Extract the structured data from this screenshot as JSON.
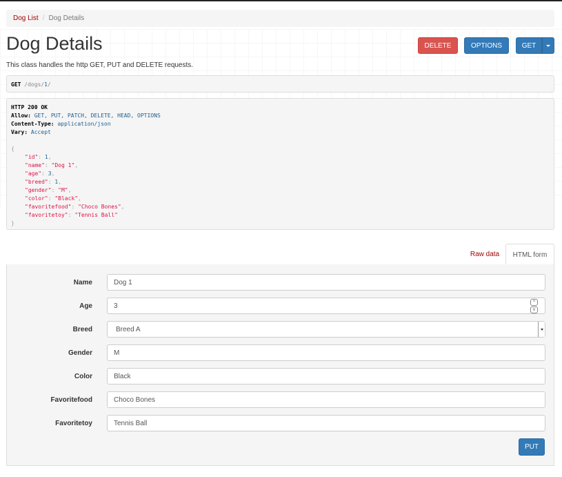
{
  "breadcrumb": {
    "home": "Dog List",
    "separator": "/",
    "current": "Dog Details"
  },
  "page": {
    "title": "Dog Details",
    "description": "This class handles the http GET, PUT and DELETE requests."
  },
  "buttons": {
    "delete": "DELETE",
    "options": "OPTIONS",
    "get": "GET"
  },
  "request": {
    "method": "GET",
    "path_prefix": " /dogs/",
    "path_id": "1",
    "path_suffix": "/"
  },
  "response": {
    "status": "HTTP 200 OK",
    "headers": [
      {
        "key": "Allow:",
        "value": "GET, PUT, PATCH, DELETE, HEAD, OPTIONS"
      },
      {
        "key": "Content-Type:",
        "value": "application/json"
      },
      {
        "key": "Vary:",
        "value": "Accept"
      }
    ],
    "open_brace": "{",
    "close_brace": "}",
    "body": [
      {
        "key": "\"id\"",
        "value": "1",
        "type": "lit",
        "comma": ","
      },
      {
        "key": "\"name\"",
        "value": "\"Dog 1\"",
        "type": "str",
        "comma": ","
      },
      {
        "key": "\"age\"",
        "value": "3",
        "type": "lit",
        "comma": ","
      },
      {
        "key": "\"breed\"",
        "value": "1",
        "type": "lit",
        "comma": ","
      },
      {
        "key": "\"gender\"",
        "value": "\"M\"",
        "type": "str",
        "comma": ","
      },
      {
        "key": "\"color\"",
        "value": "\"Black\"",
        "type": "str",
        "comma": ","
      },
      {
        "key": "\"favoritefood\"",
        "value": "\"Choco Bones\"",
        "type": "str",
        "comma": ","
      },
      {
        "key": "\"favoritetoy\"",
        "value": "\"Tennis Ball\"",
        "type": "str",
        "comma": ""
      }
    ]
  },
  "tabs": {
    "raw": "Raw data",
    "html": "HTML form"
  },
  "form": {
    "fields": [
      {
        "label": "Name",
        "value": "Dog 1"
      },
      {
        "label": "Age",
        "value": "3"
      },
      {
        "label": "Breed",
        "value": "Breed A"
      },
      {
        "label": "Gender",
        "value": "M"
      },
      {
        "label": "Color",
        "value": "Black"
      },
      {
        "label": "Favoritefood",
        "value": "Choco Bones"
      },
      {
        "label": "Favoritetoy",
        "value": "Tennis Ball"
      }
    ],
    "submit": "PUT",
    "spin_up": "^",
    "spin_down": "v"
  },
  "colors": {
    "danger": "#d9534f",
    "primary": "#337ab7",
    "link": "#a30000"
  }
}
